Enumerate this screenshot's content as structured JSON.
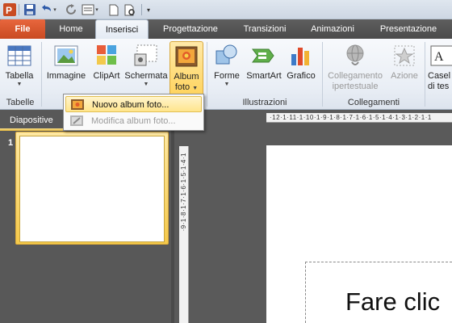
{
  "qat": {
    "icons": [
      "powerpoint-logo-icon",
      "save-icon",
      "undo-icon",
      "redo-icon",
      "layout-icon",
      "new-icon",
      "preview-icon",
      "customize-icon"
    ]
  },
  "tabs": {
    "file": "File",
    "items": [
      "Home",
      "Inserisci",
      "Progettazione",
      "Transizioni",
      "Animazioni",
      "Presentazione"
    ],
    "active": "Inserisci"
  },
  "ribbon": {
    "tabella": "Tabella",
    "immagine": "Immagine",
    "clipart": "ClipArt",
    "schermata": "Schermata",
    "album_line1": "Album",
    "album_line2": "foto",
    "forme": "Forme",
    "smartart": "SmartArt",
    "grafico": "Grafico",
    "collegamento_line1": "Collegamento",
    "collegamento_line2": "ipertestuale",
    "azione": "Azione",
    "casella_line1": "Casel",
    "casella_line2": "di tes",
    "groups": {
      "tabelle": "Tabelle",
      "illustrazioni": "Illustrazioni",
      "collegamenti": "Collegamenti"
    }
  },
  "dropdown": {
    "nuovo": "Nuovo album foto...",
    "modifica": "Modifica album foto..."
  },
  "panel": {
    "tab": "Diapositive",
    "slide_number": "1"
  },
  "rulers": {
    "horizontal": "·12·1·11·1·10·1·9·1·8·1·7·1·6·1·5·1·4·1·3·1·2·1·1",
    "vertical": "·9·1·8·1·7·1·6·1·5·1·4·1"
  },
  "slide": {
    "title_placeholder": "Fare clic"
  },
  "colors": {
    "file_tab": "#d0532a",
    "highlight": "#ffd45e",
    "workspace": "#5a5a5a"
  }
}
